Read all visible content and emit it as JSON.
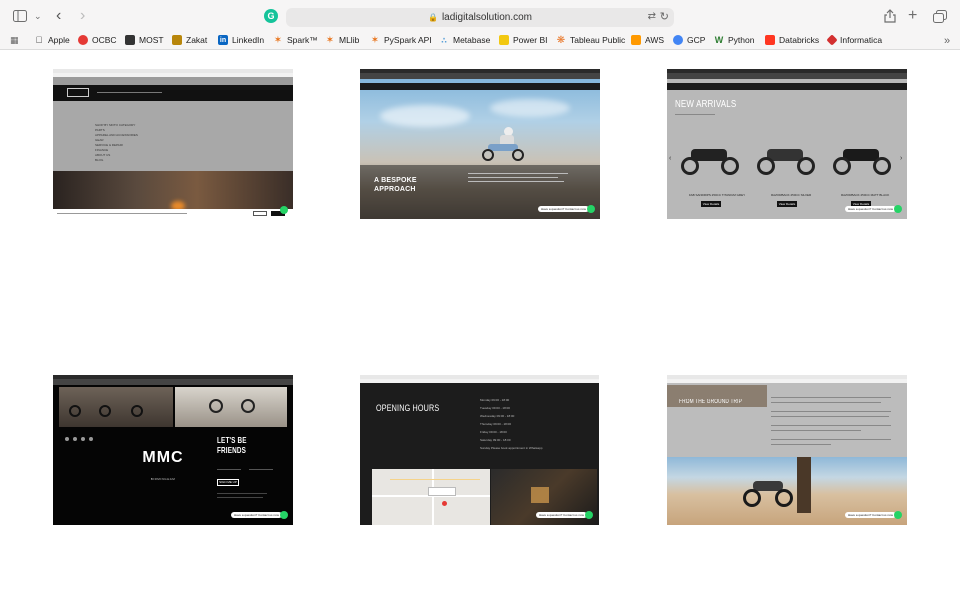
{
  "browser": {
    "url": "ladigitalsolution.com",
    "bookmarks": [
      "Apple",
      "OCBC",
      "MOST",
      "Zakat",
      "LinkedIn",
      "Spark™",
      "MLlib",
      "PySpark API",
      "Metabase",
      "Power BI",
      "Tableau Public",
      "AWS",
      "GCP",
      "Python",
      "Databricks",
      "Informatica"
    ],
    "bookmark_colors": [
      "#222222",
      "#e53935",
      "#222222",
      "#b8860b",
      "#0a66c2",
      "#e8731a",
      "#e8731a",
      "#e8731a",
      "#5aa0d8",
      "#f2c811",
      "#e97627",
      "#ff9900",
      "#4285f4",
      "#2e7d32",
      "#ff3621",
      "#d32f2f"
    ]
  },
  "thumbnails": {
    "t1": {
      "menu": [
        "SHOP BY MOTO CATEGORY",
        "PARTS",
        "APPAREL AND ACCESSORIES",
        "GEAR",
        "SERVICE & REPAIR",
        "FINANCE",
        "ABOUT US",
        "BLOG"
      ],
      "chat": "Have a question? Contact us now"
    },
    "t2": {
      "title_line1": "A BESPOKE",
      "title_line2": "APPROACH",
      "chat": "Have a question? Contact us now"
    },
    "t3": {
      "title": "NEW ARRIVALS",
      "models": [
        "FAB SANDRIPS 250CC TITANIUM GREY",
        "RAZORBACK 250CC SILVER",
        "RAZORBACK 250CC MATT BLACK"
      ],
      "btn": "View Details",
      "chat": "Have a question? Contact us now"
    },
    "t4": {
      "title": "LET'S BE FRIENDS",
      "logo": "MMC",
      "logo_sub": "BIRMINGHAM",
      "signup": "SIGN ME UP",
      "chat": "Have a question? Contact us now"
    },
    "t5": {
      "title": "OPENING HOURS",
      "hours": [
        "Monday 09:00 - 18:00",
        "Tuesday 09:00 - 18:00",
        "Wednesday 09:00 - 18:00",
        "Thursday 09:00 - 18:00",
        "Friday 09:00 - 18:00",
        "Saturday 09:00 - 18:00",
        "Sunday Please book appointment in Whatsapp"
      ],
      "chat": "Have a question? Contact us now"
    },
    "t6": {
      "title": "FROM THE GROUND TRIP",
      "chat": "Have a question? Contact us now"
    }
  }
}
